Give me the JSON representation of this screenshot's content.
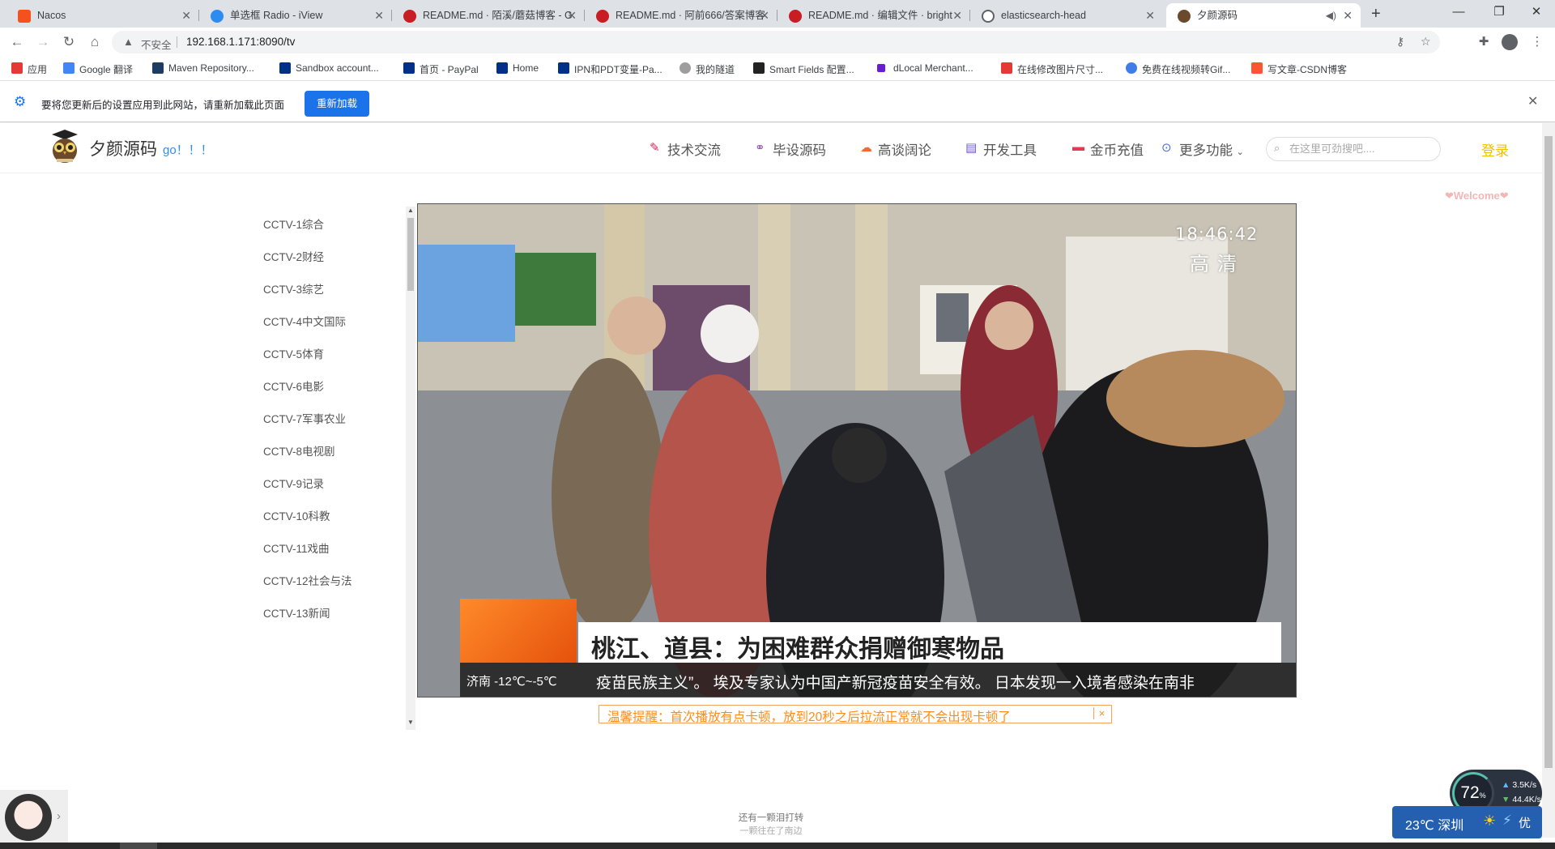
{
  "browser": {
    "tabs": [
      {
        "title": "Nacos",
        "favicon_color": "#f4511e"
      },
      {
        "title": "单选框 Radio - iView",
        "favicon_color": "#2d8cf0"
      },
      {
        "title": "README.md · 陌溪/蘑菇博客 - G",
        "favicon_color": "#c71d23"
      },
      {
        "title": "README.md · 阿前666/答案博客",
        "favicon_color": "#c71d23"
      },
      {
        "title": "README.md · 编辑文件 · bright",
        "favicon_color": "#c71d23"
      },
      {
        "title": "elasticsearch-head",
        "favicon_color": "#5f6368"
      },
      {
        "title": "夕颜源码",
        "favicon_color": "#6b4a2b"
      }
    ],
    "new_tab": "+",
    "window_controls": {
      "minimize": "—",
      "maximize": "❐",
      "close": "✕"
    },
    "address": {
      "insecure_label": "不安全",
      "url": "192.168.1.171:8090/tv"
    },
    "bookmarks": [
      {
        "label": "应用",
        "color": "#e53935"
      },
      {
        "label": "Google 翻译",
        "color": "#4285f4"
      },
      {
        "label": "Maven Repository...",
        "color": "#1d3b63"
      },
      {
        "label": "Sandbox account...",
        "color": "#003087"
      },
      {
        "label": "首页 - PayPal",
        "color": "#003087"
      },
      {
        "label": "Home",
        "color": "#003087"
      },
      {
        "label": "IPN和PDT变量-Pa...",
        "color": "#003087"
      },
      {
        "label": "我的隧道",
        "color": "#9e9e9e"
      },
      {
        "label": "Smart Fields 配置...",
        "color": "#222222"
      },
      {
        "label": "dLocal Merchant...",
        "color": "#6a1bd6"
      },
      {
        "label": "在线修改图片尺寸...",
        "color": "#e53935"
      },
      {
        "label": "免费在线视频转Gif...",
        "color": "#3f7ee8"
      },
      {
        "label": "写文章-CSDN博客",
        "color": "#fc5531"
      }
    ],
    "infobar": {
      "message": "要将您更新后的设置应用到此网站，请重新加载此页面",
      "reload_label": "重新加载"
    }
  },
  "site": {
    "name": "夕颜源码",
    "slogan": "go！！！",
    "nav": [
      {
        "label": "技术交流",
        "icon": "feather-icon",
        "color": "#e0245e"
      },
      {
        "label": "毕设源码",
        "icon": "share-icon",
        "color": "#9b59b6"
      },
      {
        "label": "高谈阔论",
        "icon": "cloud-icon",
        "color": "#f06a35"
      },
      {
        "label": "开发工具",
        "icon": "calendar-icon",
        "color": "#6a5acd"
      },
      {
        "label": "金币充值",
        "icon": "card-icon",
        "color": "#e53955"
      },
      {
        "label": "更多功能",
        "icon": "dots-icon",
        "color": "#4a6ee0"
      }
    ],
    "search_placeholder": "在这里可劲搜吧....",
    "login_label": "登录"
  },
  "welcome": "❤Welcome❤",
  "channels": [
    "CCTV-1综合",
    "CCTV-2财经",
    "CCTV-3综艺",
    "CCTV-4中文国际",
    "CCTV-5体育",
    "CCTV-6电影",
    "CCTV-7军事农业",
    "CCTV-8电视剧",
    "CCTV-9记录",
    "CCTV-10科教",
    "CCTV-11戏曲",
    "CCTV-12社会与法",
    "CCTV-13新闻"
  ],
  "player": {
    "time": "18:46:42",
    "quality": "高清",
    "headline": "桃江、道县：为困难群众捐赠御寒物品",
    "weather": "济南  -12℃~-5℃",
    "ticker": "疫苗民族主义”。        埃及专家认为中国产新冠疫苗安全有效。        日本发现一入境者感染在南非"
  },
  "tip": {
    "text": "温馨提醒：首次播放有点卡顿，放到20秒之后拉流正常就不会出现卡顿了",
    "close": "×"
  },
  "footer": {
    "line1": "还有一颗泪打转",
    "line2": "一颗往在了南边"
  },
  "widgets": {
    "cpu_percent": "72",
    "cpu_unit": "%",
    "upload": "3.5K/s",
    "download": "44.4K/s",
    "weather_text": "23℃ 深圳",
    "weather_tag": "优"
  }
}
